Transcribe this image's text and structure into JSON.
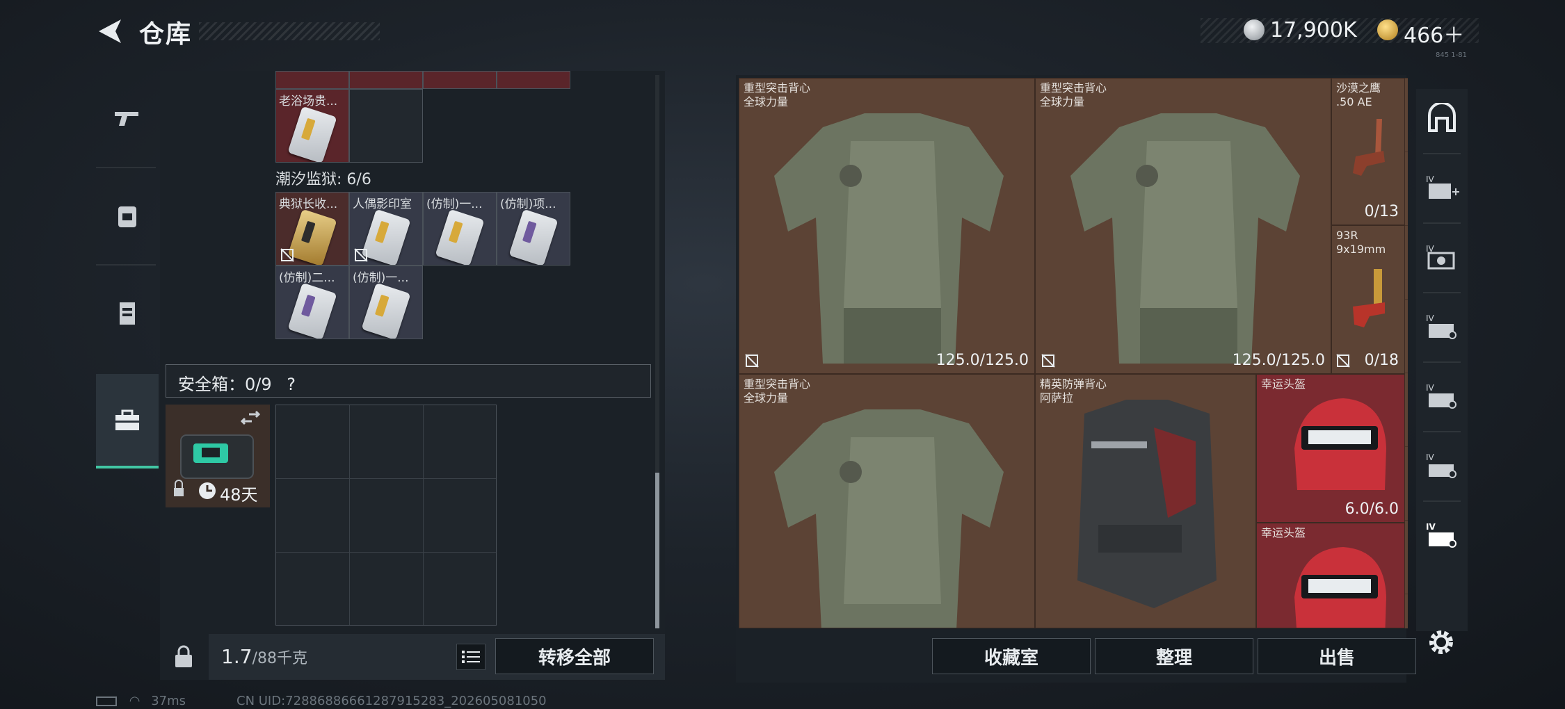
{
  "header": {
    "title": "仓库",
    "version_tag": "845 1-81"
  },
  "currency": [
    {
      "icon": "silver-coin-icon",
      "value": "17,900K"
    },
    {
      "icon": "gold-coin-icon",
      "value": "466＋"
    }
  ],
  "left_rail": [
    "pistol-icon",
    "backpack-icon",
    "vest-icon",
    "toolbox-icon"
  ],
  "inventory": {
    "top_row_item": {
      "label": "老浴场贵..."
    },
    "prison_group": {
      "label": "潮汐监狱: 6/6"
    },
    "prison_items": [
      {
        "label": "典狱长收..."
      },
      {
        "label": "人偶影印室"
      },
      {
        "label": "(仿制)一..."
      },
      {
        "label": "(仿制)项..."
      },
      {
        "label": "(仿制)二..."
      },
      {
        "label": "(仿制)一..."
      }
    ],
    "safe_box": {
      "label": "安全箱：0/9",
      "help": "?",
      "timer": "48天"
    }
  },
  "weight": {
    "value": "1.7",
    "max": "/88千克"
  },
  "buttons": {
    "transfer_all": "转移全部",
    "collection": "收藏室",
    "organize": "整理",
    "sell": "出售"
  },
  "stash_items": [
    {
      "name1": "重型突击背心",
      "name2": "全球力量",
      "durability": "125.0/125.0"
    },
    {
      "name1": "重型突击背心",
      "name2": "全球力量",
      "durability": "125.0/125.0"
    },
    {
      "name1": "沙漠之鹰",
      "name2": ".50 AE",
      "count": "0/13"
    },
    {
      "name1": "93R",
      "name2": "9x19mm",
      "count": "0/18"
    },
    {
      "name1": "重型突击背心",
      "name2": "全球力量"
    },
    {
      "name1": "精英防弹背心",
      "name2": "阿萨拉"
    },
    {
      "name1": "幸运头盔",
      "durability": "6.0/6.0"
    },
    {
      "name1": "幸运头盔"
    }
  ],
  "right_rail": [
    "map-zone-icon",
    "stash-add-icon",
    "stash-camera-icon",
    "stash-case-icon-1",
    "stash-case-icon-2",
    "stash-case-icon-3",
    "stash-case-icon-4"
  ],
  "status": {
    "latency": "37ms",
    "uid": "CN UID:72886886661287915283_202605081050"
  },
  "colors": {
    "accent": "#42c7a4",
    "stash_bg": "#5c4335",
    "red_cell": "#7b2a30"
  }
}
